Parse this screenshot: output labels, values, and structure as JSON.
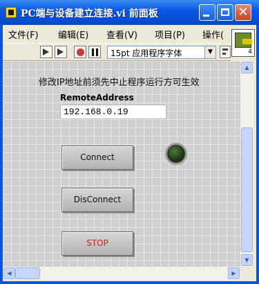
{
  "window": {
    "title": "PC端与设备建立连接.vi 前面板",
    "close_glyph": "✕"
  },
  "menu": {
    "items": [
      "文件(F)",
      "编辑(E)",
      "查看(V)",
      "项目(P)",
      "操作("
    ]
  },
  "vi_icon": {
    "connector_count": "4"
  },
  "toolbar": {
    "font_select": "15pt 应用程序字体",
    "dropdown_glyph": "▼"
  },
  "panel": {
    "notice": "修改IP地址前须先中止程序运行方可生效",
    "address_label": "RemoteAddress",
    "address_value": "192.168.0.19",
    "connect_label": "Connect",
    "disconnect_label": "DisConnect",
    "stop_label": "STOP",
    "stop_color": "#E02020",
    "led_state": "off"
  },
  "scrollbars": {
    "up_glyph": "▲",
    "down_glyph": "▼",
    "left_glyph": "◀",
    "right_glyph": "▶"
  }
}
